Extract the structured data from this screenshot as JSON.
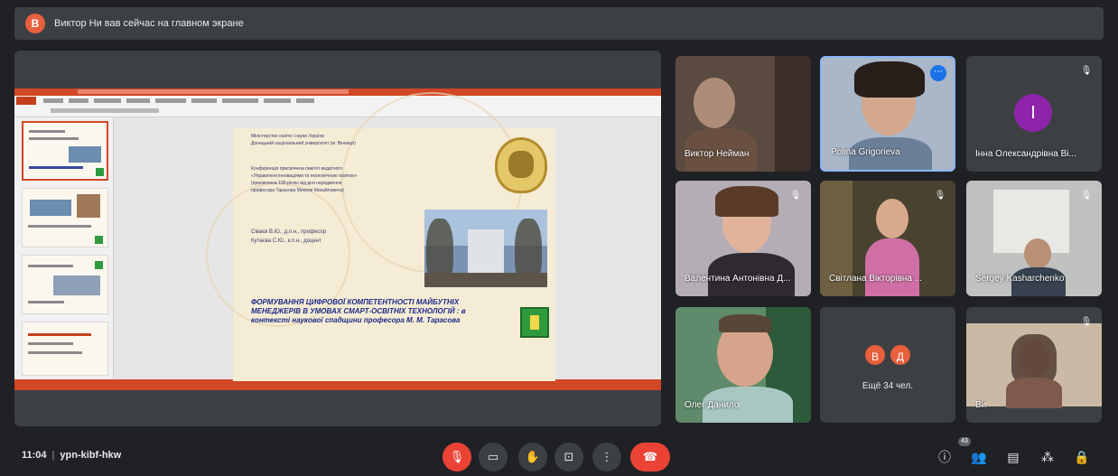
{
  "banner": {
    "avatar_letter": "В",
    "text": "Виктор Ни вав сейчас на главном экране"
  },
  "slide": {
    "org_line1": "Міністерство освіти і науки України",
    "org_line2": "Донецький національний університет (м. Вінниця)",
    "conf_line1": "Конференція присвячена пам'яті видатного",
    "conf_line2": "«Управління інноваціями та економічною освітою»",
    "conf_line3": "(присвячена 100-річчю від дня народження",
    "conf_line4": "професора Тарасова Миколи Михайловича)",
    "author1": "Сіваєв В.Ю., д.п.н., професор",
    "author2": "Кутаєва С.Ю., к.п.н., доцент",
    "main_title": "ФОРМУВАННЯ ЦИФРОВОЇ КОМПЕТЕНТНОСТІ МАЙБУТНІХ МЕНЕДЖЕРІВ В УМОВАХ СМАРТ-ОСВІТНІХ ТЕХНОЛОГІЙ : в контексті наукової спадщини професора М. М. Тарасова"
  },
  "participants": [
    {
      "name": "Виктор Нейман",
      "mic": "on"
    },
    {
      "name": "Polina Grigorieva",
      "mic": "on"
    },
    {
      "name": "Інна Олександрівна Ві...",
      "avatar_letter": "І",
      "avatar_color": "#8e24aa",
      "mic": "off"
    },
    {
      "name": "Валентина Антонівна Д...",
      "mic": "off"
    },
    {
      "name": "Світлана Вікторівна ...",
      "mic": "off"
    },
    {
      "name": "Sergey Kasharchenko",
      "mic": "off"
    },
    {
      "name": "Олег Данило",
      "mic": "on"
    },
    {
      "name": "Ещё 34 чел.",
      "avatars": [
        "В",
        "Д"
      ],
      "avatar_colors": [
        "#e8603c",
        "#e8603c"
      ]
    },
    {
      "name": "Ви",
      "mic": "off"
    }
  ],
  "bottombar": {
    "time": "11:04",
    "meeting_code": "ypn-kibf-hkw",
    "people_count": "43"
  },
  "icons": {
    "mic": "microphone-off-icon",
    "camera": "camera-icon",
    "hand": "raise-hand-icon",
    "present": "present-screen-icon",
    "more": "more-vertical-icon",
    "hangup": "hang-up-icon",
    "info": "info-icon",
    "people": "people-icon",
    "chat": "chat-icon",
    "activities": "activities-icon",
    "lock": "host-controls-icon"
  },
  "colors": {
    "background": "#202124",
    "tile": "#3c4043",
    "danger": "#ea4335",
    "accent": "#8ab4f8"
  }
}
